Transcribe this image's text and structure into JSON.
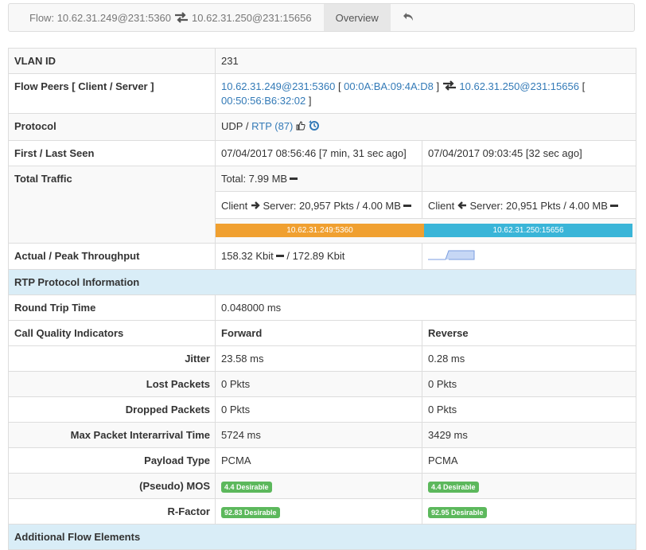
{
  "tabs": {
    "flow_prefix": "Flow:",
    "client": "10.62.31.249@231:5360",
    "server": "10.62.31.250@231:15656",
    "overview": "Overview"
  },
  "rows": {
    "vlan": {
      "label": "VLAN ID",
      "value": "231"
    },
    "peers": {
      "label": "Flow Peers [ Client / Server ]",
      "client": "10.62.31.249@231:5360",
      "client_mac": "00:0A:BA:09:4A:D8",
      "server": "10.62.31.250@231:15656",
      "server_mac": "00:50:56:B6:32:02"
    },
    "protocol": {
      "label": "Protocol",
      "l4": "UDP",
      "sep": "/",
      "l7": "RTP (87)"
    },
    "seen": {
      "label": "First / Last Seen",
      "first": "07/04/2017 08:56:46 [7 min, 31 sec ago]",
      "last": "07/04/2017 09:03:45 [32 sec ago]"
    },
    "traffic": {
      "label": "Total Traffic",
      "total": "Total: 7.99 MB",
      "client_label": "Client",
      "server_label": "Server:",
      "c2s": "20,957 Pkts / 4.00 MB",
      "s2c": "20,951 Pkts / 4.00 MB",
      "bar_client": "10.62.31.249:5360",
      "bar_server": "10.62.31.250:15656",
      "bar_client_fraction": 0.5
    },
    "throughput": {
      "label": "Actual / Peak Throughput",
      "actual": "158.32 Kbit",
      "peak": "172.89 Kbit"
    }
  },
  "rtp": {
    "section_title": "RTP Protocol Information",
    "rtt_label": "Round Trip Time",
    "rtt_value": "0.048000 ms",
    "cqi_label": "Call Quality Indicators",
    "forward": "Forward",
    "reverse": "Reverse",
    "metrics": [
      {
        "label": "Jitter",
        "fwd": "23.58 ms",
        "rev": "0.28 ms"
      },
      {
        "label": "Lost Packets",
        "fwd": "0 Pkts",
        "rev": "0 Pkts"
      },
      {
        "label": "Dropped Packets",
        "fwd": "0 Pkts",
        "rev": "0 Pkts"
      },
      {
        "label": "Max Packet Interarrival Time",
        "fwd": "5724 ms",
        "rev": "3429 ms"
      },
      {
        "label": "Payload Type",
        "fwd": "PCMA",
        "rev": "PCMA"
      }
    ],
    "mos": {
      "label": "(Pseudo) MOS",
      "fwd": "4.4 Desirable",
      "rev": "4.4 Desirable"
    },
    "rfactor": {
      "label": "R-Factor",
      "fwd": "92.83 Desirable",
      "rev": "92.95 Desirable"
    }
  },
  "next_section": "Additional Flow Elements",
  "colors": {
    "client_bar": "#f0a030",
    "server_bar": "#3ab5d8",
    "badge": "#5cb85c",
    "section_bg": "#d9edf7"
  }
}
